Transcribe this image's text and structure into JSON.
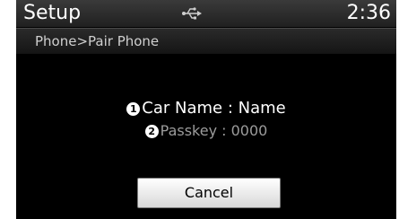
{
  "status_bar": {
    "title": "Setup",
    "usb_icon": "usb-icon",
    "time": "2:36"
  },
  "breadcrumb": {
    "text": "Phone>Pair Phone"
  },
  "info": {
    "car_name_badge": "1",
    "car_name_text": "Car Name : Name",
    "passkey_badge": "2",
    "passkey_text": "Passkey : 0000"
  },
  "actions": {
    "cancel_label": "Cancel"
  },
  "colors": {
    "background": "#000000",
    "primary_text": "#ffffff",
    "secondary_text": "#9c9c9c",
    "button_face": "#e8e8e8"
  }
}
